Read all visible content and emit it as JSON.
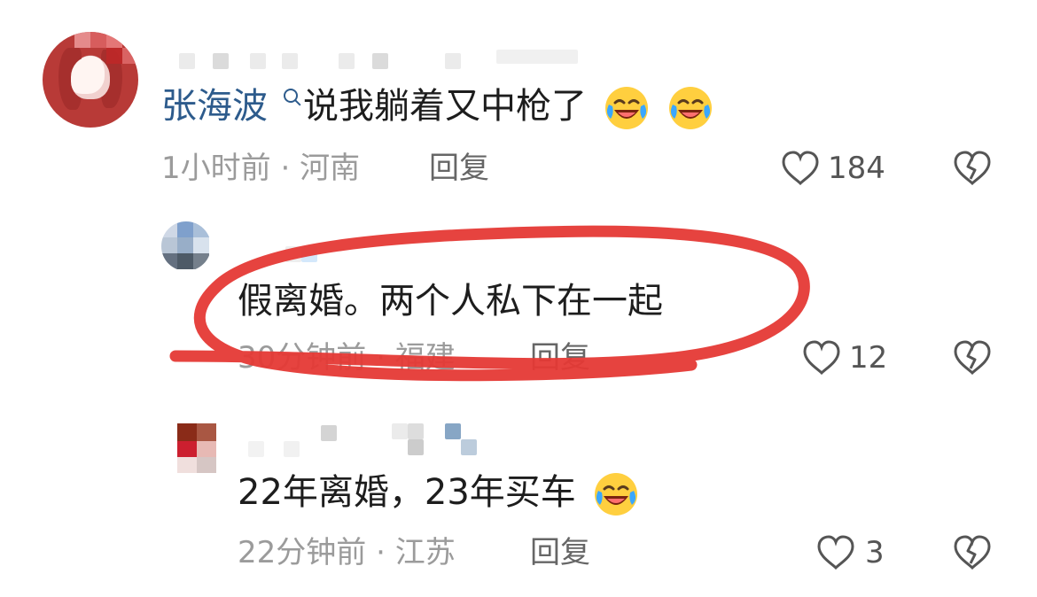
{
  "comments": [
    {
      "username": "张海波",
      "text": "说我躺着又中枪了",
      "time": "1小时前",
      "location": "河南",
      "separator": "·",
      "reply_label": "回复",
      "likes": "184",
      "emoji": "laughing-crying"
    },
    {
      "text": "假离婚。两个人私下在一起",
      "time": "30分钟前",
      "location": "福建",
      "separator": "·",
      "reply_label": "回复",
      "likes": "12"
    },
    {
      "text": "22年离婚，23年买车",
      "time": "22分钟前",
      "location": "江苏",
      "separator": "·",
      "reply_label": "回复",
      "likes": "3",
      "emoji": "laughing-crying"
    }
  ],
  "icons": {
    "like": "heart-icon",
    "dislike": "broken-heart-icon",
    "search": "search-icon"
  },
  "colors": {
    "username": "#2d5b8c",
    "highlight_circle": "#e53935",
    "meta_text": "#9b9b9b"
  }
}
